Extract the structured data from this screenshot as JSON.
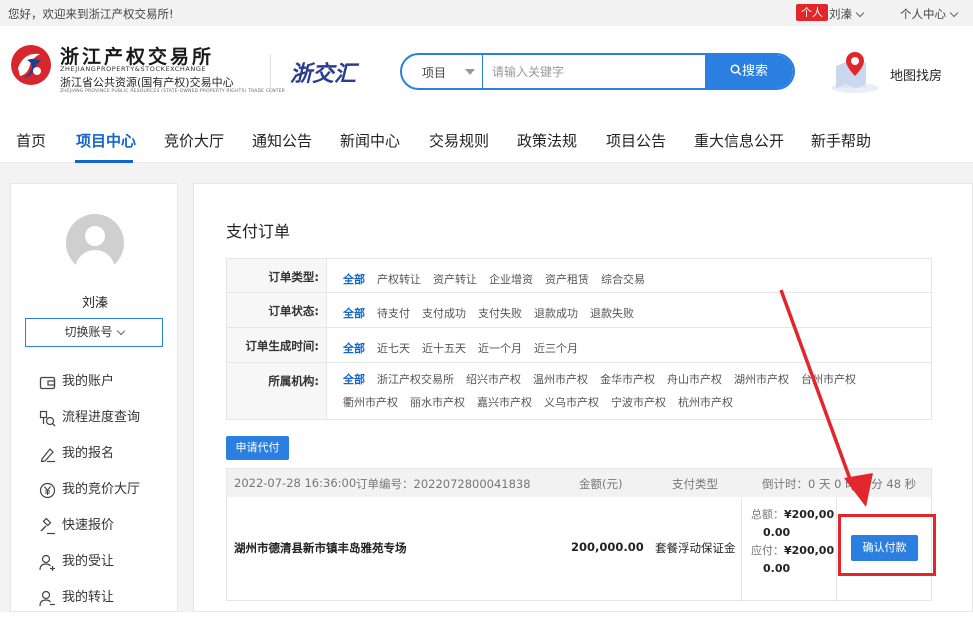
{
  "topbar": {
    "welcome": "您好，欢迎来到浙江产权交易所!",
    "badge": "个人",
    "user": "刘溱",
    "center": "个人中心"
  },
  "header": {
    "logo_cn": "浙江产权交易所",
    "logo_en": "ZHEJIANGPROPERTY&STOCKEXCHANGE",
    "logo_sub": "浙江省公共资源(国有产权)交易中心",
    "logo_tiny": "ZHEJIANG PROVINCE PUBLIC RESOURCES (STATE-OWNED PROPERTY RIGHTS) TRADE CENTER",
    "brand2": "浙交汇",
    "search_type": "项目",
    "search_placeholder": "请输入关键字",
    "search_button": "搜索",
    "map_find": "地图找房"
  },
  "nav": [
    "首页",
    "项目中心",
    "竞价大厅",
    "通知公告",
    "新闻中心",
    "交易规则",
    "政策法规",
    "项目公告",
    "重大信息公开",
    "新手帮助"
  ],
  "sidebar": {
    "name": "刘溱",
    "switch": "切换账号",
    "menu": [
      {
        "label": "我的账户",
        "icon": "wallet-icon"
      },
      {
        "label": "流程进度查询",
        "icon": "flow-search-icon"
      },
      {
        "label": "我的报名",
        "icon": "sign-pen-icon"
      },
      {
        "label": "我的竞价大厅",
        "icon": "yuan-circle-icon"
      },
      {
        "label": "快速报价",
        "icon": "gavel-icon"
      },
      {
        "label": "我的受让",
        "icon": "user-add-icon"
      },
      {
        "label": "我的转让",
        "icon": "user-transfer-icon"
      }
    ]
  },
  "content": {
    "title": "支付订单",
    "filters": [
      {
        "label": "订单类型:",
        "options": [
          "全部",
          "产权转让",
          "资产转让",
          "企业增资",
          "资产租赁",
          "综合交易"
        ]
      },
      {
        "label": "订单状态:",
        "options": [
          "全部",
          "待支付",
          "支付成功",
          "支付失败",
          "退款成功",
          "退款失败"
        ]
      },
      {
        "label": "订单生成时间:",
        "options": [
          "全部",
          "近七天",
          "近十五天",
          "近一个月",
          "近三个月"
        ]
      },
      {
        "label": "所属机构:",
        "options": [
          "全部",
          "浙江产权交易所",
          "绍兴市产权",
          "温州市产权",
          "金华市产权",
          "舟山市产权",
          "湖州市产权",
          "台州市产权",
          "衢州市产权",
          "丽水市产权",
          "嘉兴市产权",
          "义乌市产权",
          "宁波市产权",
          "杭州市产权"
        ]
      }
    ],
    "apply_button": "申请代付",
    "order": {
      "datetime": "2022-07-28  16:36:00",
      "order_no": "订单编号：2022072800041838",
      "amount_header": "金额(元)",
      "paytype_header": "支付类型",
      "countdown": "倒计时：0 天 0 时 0 分 48 秒",
      "name": "湖州市德清县新市镇丰岛雅苑专场",
      "amount": "200,000.00",
      "pay_type": "套餐浮动保证金",
      "total_label": "总额：",
      "total_value_1": "¥200,00",
      "total_value_2": "0.00",
      "due_label": "应付：",
      "due_value_1": "¥200,00",
      "due_value_2": "0.00",
      "confirm": "确认付款"
    }
  },
  "colors": {
    "accent": "#2b7fe0",
    "nav_active": "#1166cc",
    "highlight": "#e3262b"
  }
}
